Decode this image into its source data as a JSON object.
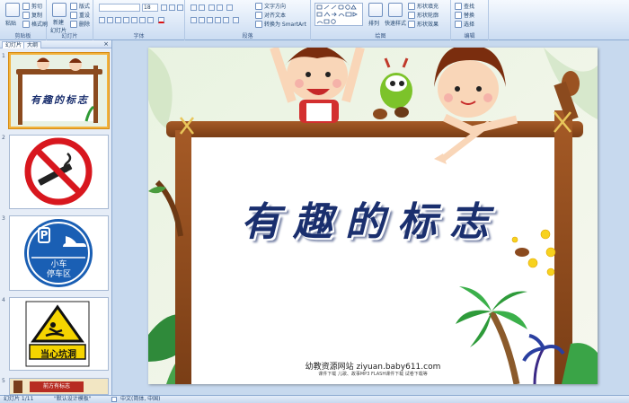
{
  "ribbon": {
    "clipboard": {
      "group_label": "剪贴板",
      "paste": "粘贴",
      "cut": "剪切",
      "copy": "复制",
      "format_painter": "格式刷"
    },
    "slides": {
      "group_label": "幻灯片",
      "new_slide": "新建",
      "new_slide2": "幻灯片",
      "layout": "版式",
      "reset": "重设",
      "delete": "删除"
    },
    "font": {
      "group_label": "字体",
      "font_size": "18"
    },
    "paragraph": {
      "group_label": "段落",
      "text_direction": "文字方向",
      "align_text": "对齐文本",
      "smartart": "转换为 SmartArt"
    },
    "drawing": {
      "group_label": "绘图",
      "arrange": "排列",
      "quick_styles": "快速样式",
      "shape_fill": "形状填充",
      "shape_outline": "形状轮廓",
      "shape_effects": "形状效果"
    },
    "editing": {
      "group_label": "编辑",
      "find": "查找",
      "replace": "替换",
      "select": "选择"
    }
  },
  "panel": {
    "tab_slides": "幻灯片",
    "tab_outline": "大纲",
    "close": "×",
    "thumbs": [
      {
        "num": "1",
        "title": "有趣的标志"
      },
      {
        "num": "2",
        "title": ""
      },
      {
        "num": "3",
        "title": "P",
        "sub1": "小车",
        "sub2": "停车区"
      },
      {
        "num": "4",
        "title": "当心坑洞"
      },
      {
        "num": "5",
        "title": "前方有标志"
      }
    ]
  },
  "slide": {
    "title": "有趣的标志",
    "credit_main": "幼教资源网站  ziyuan.baby611.com",
    "credit_sub": "课件下载  儿歌、故事MP3  FLASH课件下载  试卷下载等"
  },
  "status": {
    "slide_count": "幻灯片 1/11",
    "theme": "\"默认设计模板\"",
    "language": "中文(简体, 中国)"
  },
  "colors": {
    "title_blue": "#1a2f6e",
    "wood": "#8b4a1e",
    "no_smoking_red": "#d8171e",
    "parking_blue": "#1a5fb4",
    "warning_yellow": "#f5d400"
  }
}
